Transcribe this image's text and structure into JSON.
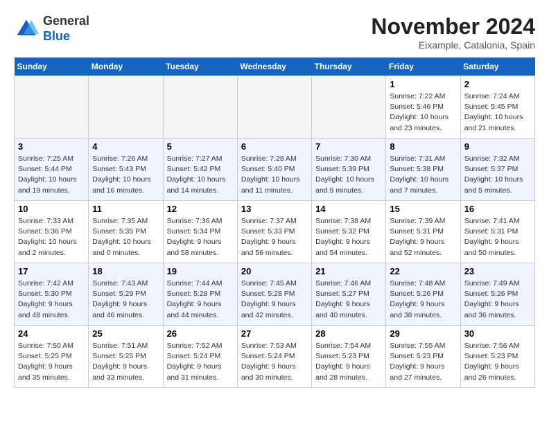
{
  "logo": {
    "general": "General",
    "blue": "Blue"
  },
  "header": {
    "month_title": "November 2024",
    "location": "Eixample, Catalonia, Spain"
  },
  "weekdays": [
    "Sunday",
    "Monday",
    "Tuesday",
    "Wednesday",
    "Thursday",
    "Friday",
    "Saturday"
  ],
  "weeks": [
    [
      {
        "day": "",
        "info": ""
      },
      {
        "day": "",
        "info": ""
      },
      {
        "day": "",
        "info": ""
      },
      {
        "day": "",
        "info": ""
      },
      {
        "day": "",
        "info": ""
      },
      {
        "day": "1",
        "info": "Sunrise: 7:22 AM\nSunset: 5:46 PM\nDaylight: 10 hours and 23 minutes."
      },
      {
        "day": "2",
        "info": "Sunrise: 7:24 AM\nSunset: 5:45 PM\nDaylight: 10 hours and 21 minutes."
      }
    ],
    [
      {
        "day": "3",
        "info": "Sunrise: 7:25 AM\nSunset: 5:44 PM\nDaylight: 10 hours and 19 minutes."
      },
      {
        "day": "4",
        "info": "Sunrise: 7:26 AM\nSunset: 5:43 PM\nDaylight: 10 hours and 16 minutes."
      },
      {
        "day": "5",
        "info": "Sunrise: 7:27 AM\nSunset: 5:42 PM\nDaylight: 10 hours and 14 minutes."
      },
      {
        "day": "6",
        "info": "Sunrise: 7:28 AM\nSunset: 5:40 PM\nDaylight: 10 hours and 11 minutes."
      },
      {
        "day": "7",
        "info": "Sunrise: 7:30 AM\nSunset: 5:39 PM\nDaylight: 10 hours and 9 minutes."
      },
      {
        "day": "8",
        "info": "Sunrise: 7:31 AM\nSunset: 5:38 PM\nDaylight: 10 hours and 7 minutes."
      },
      {
        "day": "9",
        "info": "Sunrise: 7:32 AM\nSunset: 5:37 PM\nDaylight: 10 hours and 5 minutes."
      }
    ],
    [
      {
        "day": "10",
        "info": "Sunrise: 7:33 AM\nSunset: 5:36 PM\nDaylight: 10 hours and 2 minutes."
      },
      {
        "day": "11",
        "info": "Sunrise: 7:35 AM\nSunset: 5:35 PM\nDaylight: 10 hours and 0 minutes."
      },
      {
        "day": "12",
        "info": "Sunrise: 7:36 AM\nSunset: 5:34 PM\nDaylight: 9 hours and 58 minutes."
      },
      {
        "day": "13",
        "info": "Sunrise: 7:37 AM\nSunset: 5:33 PM\nDaylight: 9 hours and 56 minutes."
      },
      {
        "day": "14",
        "info": "Sunrise: 7:38 AM\nSunset: 5:32 PM\nDaylight: 9 hours and 54 minutes."
      },
      {
        "day": "15",
        "info": "Sunrise: 7:39 AM\nSunset: 5:31 PM\nDaylight: 9 hours and 52 minutes."
      },
      {
        "day": "16",
        "info": "Sunrise: 7:41 AM\nSunset: 5:31 PM\nDaylight: 9 hours and 50 minutes."
      }
    ],
    [
      {
        "day": "17",
        "info": "Sunrise: 7:42 AM\nSunset: 5:30 PM\nDaylight: 9 hours and 48 minutes."
      },
      {
        "day": "18",
        "info": "Sunrise: 7:43 AM\nSunset: 5:29 PM\nDaylight: 9 hours and 46 minutes."
      },
      {
        "day": "19",
        "info": "Sunrise: 7:44 AM\nSunset: 5:28 PM\nDaylight: 9 hours and 44 minutes."
      },
      {
        "day": "20",
        "info": "Sunrise: 7:45 AM\nSunset: 5:28 PM\nDaylight: 9 hours and 42 minutes."
      },
      {
        "day": "21",
        "info": "Sunrise: 7:46 AM\nSunset: 5:27 PM\nDaylight: 9 hours and 40 minutes."
      },
      {
        "day": "22",
        "info": "Sunrise: 7:48 AM\nSunset: 5:26 PM\nDaylight: 9 hours and 38 minutes."
      },
      {
        "day": "23",
        "info": "Sunrise: 7:49 AM\nSunset: 5:26 PM\nDaylight: 9 hours and 36 minutes."
      }
    ],
    [
      {
        "day": "24",
        "info": "Sunrise: 7:50 AM\nSunset: 5:25 PM\nDaylight: 9 hours and 35 minutes."
      },
      {
        "day": "25",
        "info": "Sunrise: 7:51 AM\nSunset: 5:25 PM\nDaylight: 9 hours and 33 minutes."
      },
      {
        "day": "26",
        "info": "Sunrise: 7:52 AM\nSunset: 5:24 PM\nDaylight: 9 hours and 31 minutes."
      },
      {
        "day": "27",
        "info": "Sunrise: 7:53 AM\nSunset: 5:24 PM\nDaylight: 9 hours and 30 minutes."
      },
      {
        "day": "28",
        "info": "Sunrise: 7:54 AM\nSunset: 5:23 PM\nDaylight: 9 hours and 28 minutes."
      },
      {
        "day": "29",
        "info": "Sunrise: 7:55 AM\nSunset: 5:23 PM\nDaylight: 9 hours and 27 minutes."
      },
      {
        "day": "30",
        "info": "Sunrise: 7:56 AM\nSunset: 5:23 PM\nDaylight: 9 hours and 26 minutes."
      }
    ]
  ]
}
